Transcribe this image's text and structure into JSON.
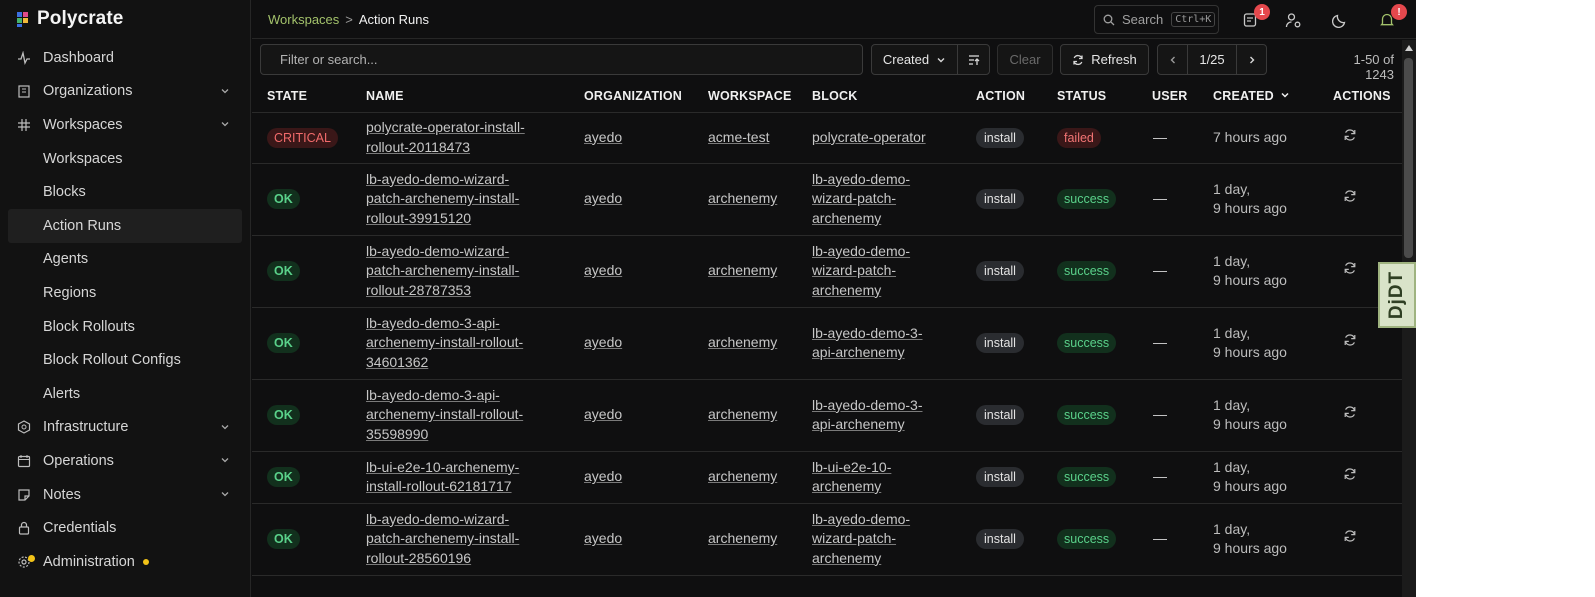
{
  "app": {
    "name": "Polycrate"
  },
  "colors": {
    "accent": "#a3c26b",
    "critical": "#f26b6b",
    "success": "#5ad18a",
    "warning": "#f2c318",
    "danger": "#e5484d"
  },
  "sidebar": {
    "items": [
      {
        "label": "Dashboard",
        "icon": "activity-icon"
      },
      {
        "label": "Organizations",
        "icon": "building-icon",
        "expandable": true
      },
      {
        "label": "Workspaces",
        "icon": "grid-icon",
        "expandable": true,
        "expanded": true
      },
      {
        "label": "Workspaces",
        "sub": true
      },
      {
        "label": "Blocks",
        "sub": true
      },
      {
        "label": "Action Runs",
        "sub": true,
        "active": true
      },
      {
        "label": "Agents",
        "sub": true
      },
      {
        "label": "Regions",
        "sub": true
      },
      {
        "label": "Block Rollouts",
        "sub": true
      },
      {
        "label": "Block Rollout Configs",
        "sub": true
      },
      {
        "label": "Alerts",
        "sub": true
      },
      {
        "label": "Infrastructure",
        "icon": "hexagon-icon",
        "expandable": true
      },
      {
        "label": "Operations",
        "icon": "calendar-icon",
        "expandable": true
      },
      {
        "label": "Notes",
        "icon": "note-icon",
        "expandable": true
      },
      {
        "label": "Credentials",
        "icon": "lock-icon"
      },
      {
        "label": "Administration",
        "icon": "gear-icon"
      }
    ]
  },
  "breadcrumb": {
    "parent": "Workspaces",
    "separator": ">",
    "current": "Action Runs"
  },
  "topbar": {
    "search_label": "Search",
    "search_shortcut": "Ctrl+K",
    "notes_badge": "1",
    "alerts_badge": "!"
  },
  "toolbar": {
    "filter_placeholder": "Filter or search...",
    "sort_field": "Created",
    "clear_label": "Clear",
    "refresh_label": "Refresh",
    "page_indicator": "1/25",
    "result_count": "1-50 of 1243"
  },
  "table": {
    "columns": [
      "STATE",
      "NAME",
      "ORGANIZATION",
      "WORKSPACE",
      "BLOCK",
      "ACTION",
      "STATUS",
      "USER",
      "CREATED",
      "ACTIONS"
    ],
    "rows": [
      {
        "state": "CRITICAL",
        "name": [
          "polycrate-operator-install-",
          "rollout-20118473"
        ],
        "organization": "ayedo",
        "workspace": "acme-test",
        "block": [
          "polycrate-operator"
        ],
        "action": "install",
        "status": "failed",
        "user": "—",
        "created": [
          "7 hours ago"
        ]
      },
      {
        "state": "OK",
        "name": [
          "lb-ayedo-demo-wizard-",
          "patch-archenemy-install-",
          "rollout-39915120"
        ],
        "organization": "ayedo",
        "workspace": "archenemy",
        "block": [
          "lb-ayedo-demo-",
          "wizard-patch-",
          "archenemy"
        ],
        "action": "install",
        "status": "success",
        "user": "—",
        "created": [
          "1 day,",
          "9 hours ago"
        ]
      },
      {
        "state": "OK",
        "name": [
          "lb-ayedo-demo-wizard-",
          "patch-archenemy-install-",
          "rollout-28787353"
        ],
        "organization": "ayedo",
        "workspace": "archenemy",
        "block": [
          "lb-ayedo-demo-",
          "wizard-patch-",
          "archenemy"
        ],
        "action": "install",
        "status": "success",
        "user": "—",
        "created": [
          "1 day,",
          "9 hours ago"
        ]
      },
      {
        "state": "OK",
        "name": [
          "lb-ayedo-demo-3-api-",
          "archenemy-install-rollout-",
          "34601362"
        ],
        "organization": "ayedo",
        "workspace": "archenemy",
        "block": [
          "lb-ayedo-demo-3-",
          "api-archenemy"
        ],
        "action": "install",
        "status": "success",
        "user": "—",
        "created": [
          "1 day,",
          "9 hours ago"
        ]
      },
      {
        "state": "OK",
        "name": [
          "lb-ayedo-demo-3-api-",
          "archenemy-install-rollout-",
          "35598990"
        ],
        "organization": "ayedo",
        "workspace": "archenemy",
        "block": [
          "lb-ayedo-demo-3-",
          "api-archenemy"
        ],
        "action": "install",
        "status": "success",
        "user": "—",
        "created": [
          "1 day,",
          "9 hours ago"
        ]
      },
      {
        "state": "OK",
        "name": [
          "lb-ui-e2e-10-archenemy-",
          "install-rollout-62181717"
        ],
        "organization": "ayedo",
        "workspace": "archenemy",
        "block": [
          "lb-ui-e2e-10-",
          "archenemy"
        ],
        "action": "install",
        "status": "success",
        "user": "—",
        "created": [
          "1 day,",
          "9 hours ago"
        ]
      },
      {
        "state": "OK",
        "name": [
          "lb-ayedo-demo-wizard-",
          "patch-archenemy-install-",
          "rollout-28560196"
        ],
        "organization": "ayedo",
        "workspace": "archenemy",
        "block": [
          "lb-ayedo-demo-",
          "wizard-patch-",
          "archenemy"
        ],
        "action": "install",
        "status": "success",
        "user": "—",
        "created": [
          "1 day,",
          "9 hours ago"
        ]
      }
    ]
  },
  "debug_toolbar": {
    "label": "DjDT"
  }
}
